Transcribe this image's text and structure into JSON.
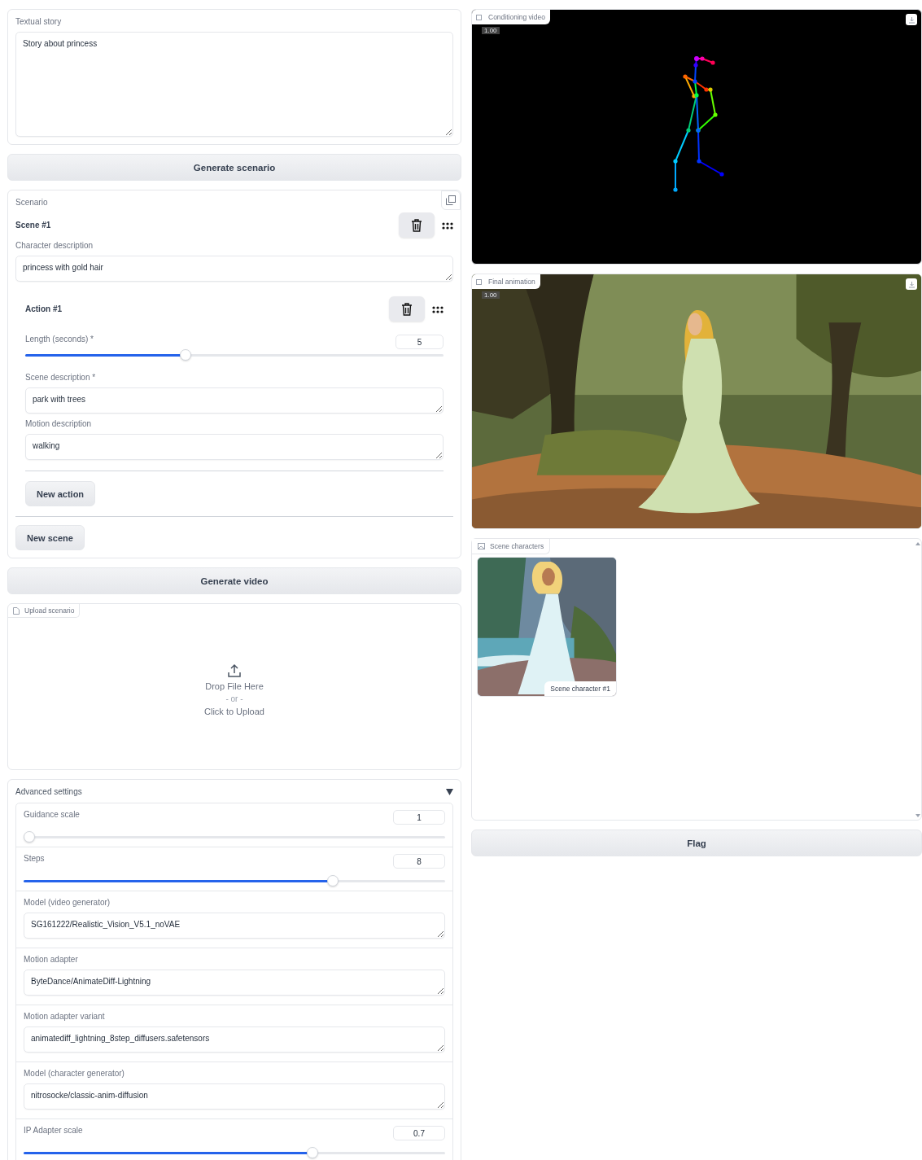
{
  "textual_story": {
    "label": "Textual story",
    "value": "Story about princess"
  },
  "generate_scenario_button": "Generate scenario",
  "scenario": {
    "label": "Scenario",
    "scenes": [
      {
        "title": "Scene #1",
        "character_label": "Character description",
        "character_value": "princess with gold hair",
        "actions": [
          {
            "title": "Action #1",
            "length": {
              "label": "Length (seconds) *",
              "value": "5",
              "level": 0.38
            },
            "scene_description": {
              "label": "Scene description *",
              "value": "park with trees"
            },
            "motion_description": {
              "label": "Motion description",
              "value": "walking"
            }
          }
        ],
        "new_action_button": "New action"
      }
    ],
    "new_scene_button": "New scene"
  },
  "generate_video_button": "Generate video",
  "upload": {
    "label": "Upload scenario",
    "drop_text": "Drop File Here",
    "or_text": "- or -",
    "click_text": "Click to Upload"
  },
  "advanced_settings": {
    "label": "Advanced settings",
    "expanded": true,
    "settings": [
      {
        "kind": "slider",
        "label": "Guidance scale",
        "value": "1",
        "level": 0
      },
      {
        "kind": "slider",
        "label": "Steps",
        "value": "8",
        "level": 0.74
      },
      {
        "kind": "text",
        "label": "Model (video generator)",
        "value": "SG161222/Realistic_Vision_V5.1_noVAE"
      },
      {
        "kind": "text",
        "label": "Motion adapter",
        "value": "ByteDance/AnimateDiff-Lightning"
      },
      {
        "kind": "text",
        "label": "Motion adapter variant",
        "value": "animatediff_lightning_8step_diffusers.safetensors"
      },
      {
        "kind": "text",
        "label": "Model (character generator)",
        "value": "nitrosocke/classic-anim-diffusion"
      },
      {
        "kind": "slider",
        "label": "IP Adapter scale",
        "value": "0.7",
        "level": 0.69
      }
    ]
  },
  "conditioning_video": {
    "label": "Conditioning video",
    "progress": "1.00"
  },
  "final_animation": {
    "label": "Final animation",
    "progress": "1.00"
  },
  "scene_characters": {
    "label": "Scene characters",
    "items": [
      {
        "caption": "Scene character #1"
      }
    ]
  },
  "flag_button": "Flag"
}
